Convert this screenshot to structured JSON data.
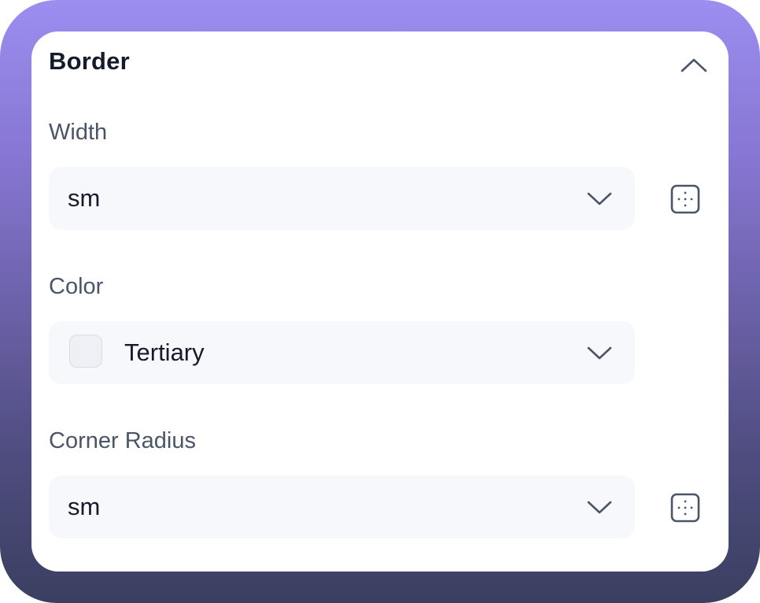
{
  "section": {
    "title": "Border",
    "collapse_icon": "chevron-up-icon"
  },
  "fields": {
    "width": {
      "label": "Width",
      "value": "sm",
      "side_icon": "dotted-square-icon"
    },
    "color": {
      "label": "Color",
      "value": "Tertiary",
      "swatch_color": "#eef0f5"
    },
    "corner_radius": {
      "label": "Corner Radius",
      "value": "sm",
      "side_icon": "dotted-square-icon"
    }
  },
  "colors": {
    "frame_gradient_top": "#9b8ef0",
    "frame_gradient_bottom": "#3a3f60",
    "panel_bg": "#ffffff",
    "select_bg": "#f7f8fc",
    "text_primary": "#151b2d",
    "text_label": "#4b5568"
  }
}
